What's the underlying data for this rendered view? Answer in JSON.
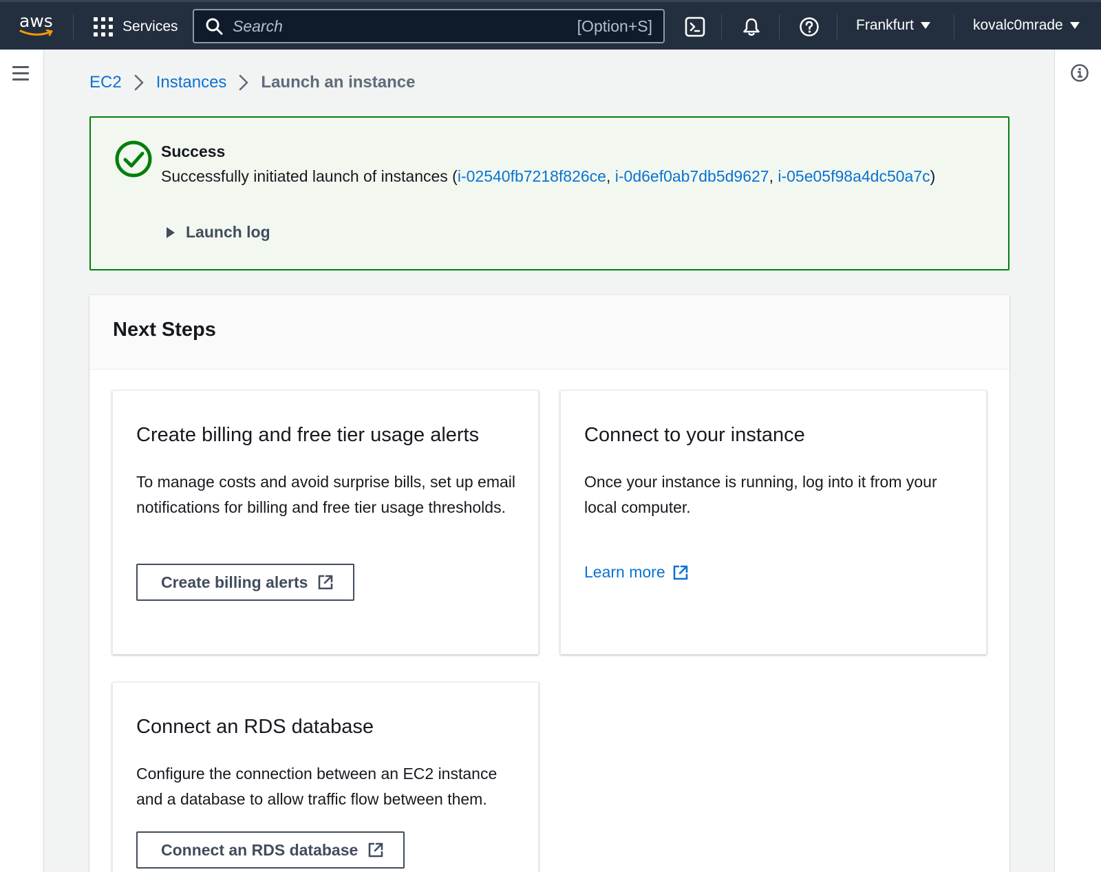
{
  "topnav": {
    "logo_text": "aws",
    "services_label": "Services",
    "search_placeholder": "Search",
    "search_shortcut": "[Option+S]",
    "region": "Frankfurt",
    "account": "kovalc0mrade"
  },
  "breadcrumb": {
    "items": [
      "EC2",
      "Instances"
    ],
    "current": "Launch an instance"
  },
  "flash": {
    "status": "success",
    "title": "Success",
    "message_prefix": "Successfully initiated launch of instances (",
    "instance_ids": [
      "i-02540fb7218f826ce",
      "i-0d6ef0ab7db5d9627",
      "i-05e05f98a4dc50a7c"
    ],
    "separator": ", ",
    "message_suffix": ")",
    "launch_log_label": "Launch log"
  },
  "next_steps": {
    "title": "Next Steps",
    "cards": [
      {
        "title": "Create billing and free tier usage alerts",
        "description": "To manage costs and avoid surprise bills, set up email notifications for billing and free tier usage thresholds.",
        "action_label": "Create billing alerts"
      },
      {
        "title": "Connect to your instance",
        "description": "Once your instance is running, log into it from your local computer.",
        "action_label": "Learn more"
      },
      {
        "title": "Connect an RDS database",
        "description": "Configure the connection between an EC2 instance and a database to allow traffic flow between them.",
        "action_label": "Connect an RDS database"
      }
    ]
  },
  "colors": {
    "nav_bg": "#232f3e",
    "link": "#0972d3",
    "success": "#037f0c",
    "success_bg": "#f2f8f0",
    "page_bg": "#f2f3f3"
  },
  "icons": [
    "services-grid-icon",
    "search-icon",
    "cloudshell-icon",
    "bell-icon",
    "help-icon",
    "menu-icon",
    "info-icon",
    "check-circle-icon",
    "external-link-icon",
    "caret-right-icon"
  ]
}
